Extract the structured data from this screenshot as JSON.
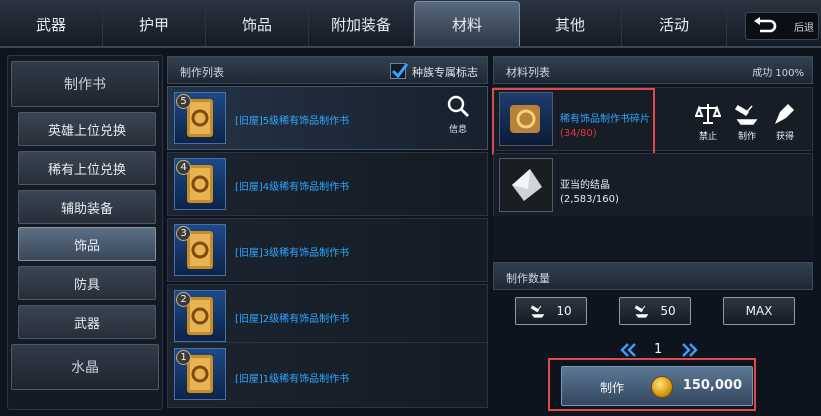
{
  "tabs": [
    {
      "label": "武器",
      "active": false
    },
    {
      "label": "护甲",
      "active": false
    },
    {
      "label": "饰品",
      "active": false
    },
    {
      "label": "附加装备",
      "active": false
    },
    {
      "label": "材料",
      "active": true
    },
    {
      "label": "其他",
      "active": false
    },
    {
      "label": "活动",
      "active": false
    }
  ],
  "back_label": "后退",
  "sidebar": {
    "category_top": "制作书",
    "items": [
      {
        "label": "英雄上位兑换",
        "selected": false
      },
      {
        "label": "稀有上位兑换",
        "selected": false
      },
      {
        "label": "辅助装备",
        "selected": false
      },
      {
        "label": "饰品",
        "selected": true
      },
      {
        "label": "防具",
        "selected": false
      },
      {
        "label": "武器",
        "selected": false
      }
    ],
    "category_bottom": "水晶"
  },
  "craft_list": {
    "title": "制作列表",
    "race_checkbox_label": "种族专属标志",
    "race_checkbox_checked": true,
    "info_label": "信息",
    "items": [
      {
        "level": "5",
        "name": "[旧屋]5级稀有饰品制作书"
      },
      {
        "level": "4",
        "name": "[旧屋]4级稀有饰品制作书"
      },
      {
        "level": "3",
        "name": "[旧屋]3级稀有饰品制作书"
      },
      {
        "level": "2",
        "name": "[旧屋]2级稀有饰品制作书"
      },
      {
        "level": "1",
        "name": "[旧屋]1级稀有饰品制作书"
      }
    ]
  },
  "materials": {
    "title": "材料列表",
    "success_rate": "成功 100%",
    "items": [
      {
        "name": "稀有饰品制作书碎片",
        "count": "(34/80)",
        "name_color": "#2fa8ff",
        "count_color": "#e03a3a"
      },
      {
        "name": "亚当的结晶",
        "count": "(2,583/160)",
        "name_color": "#e7ebf0",
        "count_color": "#e7ebf0"
      }
    ],
    "actions": [
      {
        "label": "禁止",
        "icon": "balance-icon"
      },
      {
        "label": "制作",
        "icon": "hammer-anvil-icon"
      },
      {
        "label": "获得",
        "icon": "hunt-icon"
      }
    ]
  },
  "quantity": {
    "title": "制作数量",
    "btn10": "10",
    "btn50": "50",
    "btnmax": "MAX",
    "current": "1"
  },
  "craft_button": {
    "label": "制作",
    "price": "150,000"
  }
}
